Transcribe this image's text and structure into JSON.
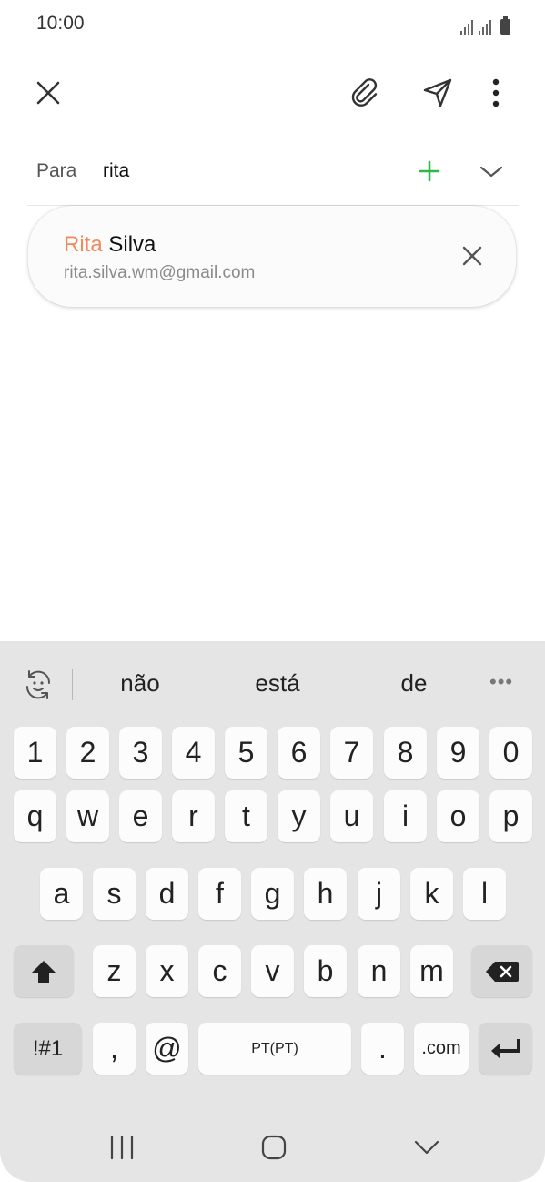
{
  "status_bar": {
    "time": "10:00"
  },
  "toolbar": {
    "close_icon": "close-icon",
    "attach_icon": "paperclip-icon",
    "send_icon": "send-icon",
    "more_icon": "more-vertical-icon"
  },
  "recipient": {
    "label": "Para",
    "value": "rita"
  },
  "suggestion": {
    "name_match": "Rita",
    "name_rest": " Silva",
    "email": "rita.silva.wm@gmail.com"
  },
  "keyboard": {
    "suggestions": [
      "não",
      "está",
      "de"
    ],
    "more": "•••",
    "numbers": [
      "1",
      "2",
      "3",
      "4",
      "5",
      "6",
      "7",
      "8",
      "9",
      "0"
    ],
    "row_q": [
      "q",
      "w",
      "e",
      "r",
      "t",
      "y",
      "u",
      "i",
      "o",
      "p"
    ],
    "row_a": [
      "a",
      "s",
      "d",
      "f",
      "g",
      "h",
      "j",
      "k",
      "l"
    ],
    "row_z": [
      "z",
      "x",
      "c",
      "v",
      "b",
      "n",
      "m"
    ],
    "symbols_label": "!#1",
    "comma": ",",
    "at": "@",
    "space_label": "PT(PT)",
    "period": ".",
    "dotcom": ".com"
  },
  "colors": {
    "accent_add": "#2fb84a",
    "name_highlight": "#f08a5d",
    "keyboard_bg": "#e5e5e5"
  }
}
